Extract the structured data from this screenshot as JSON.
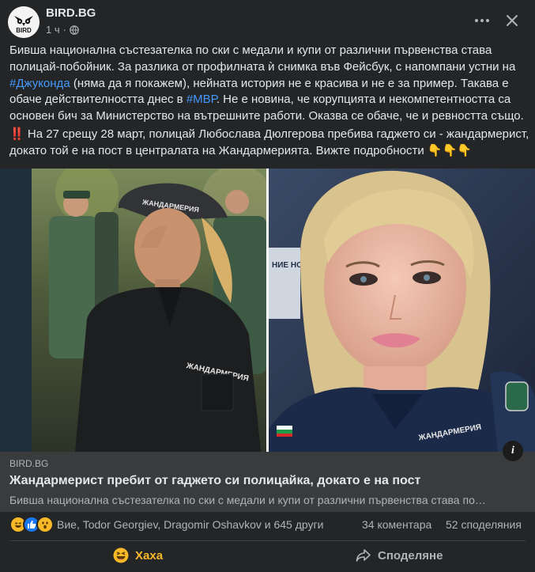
{
  "header": {
    "page_name": "BIRD.BG",
    "avatar_text": "BIRD",
    "time": "1 ч",
    "dot": "·"
  },
  "post": {
    "paragraph1_part1": "Бивша национална състезателка по ски с медали и купи от различни първенства става полицай-побойник. За разлика от профилната ѝ снимка във Фейсбук, с напомпани устни на ",
    "hashtag1": "#Джуконда",
    "paragraph1_part2": " (няма да я покажем), нейната история не е красива и не е за пример. Такава е обаче действителността днес в ",
    "hashtag2": "#МВР",
    "paragraph1_part3": ". Не е новина, че корупцията и некомпетентността са основен бич за Министерство на вътрешните работи. Оказва се обаче, че и ревността също.",
    "paragraph2_icon": "‼️",
    "paragraph2": " На 27 срещу 28 март, полицай Любослава Дюлгерова пребива гаджето си - жандармерист, докато той е на пост в централата на Жандармерията. Вижте подробности ",
    "paragraph2_emoji": "👇👇👇"
  },
  "images": {
    "left_cap_text": "ЖАНДАРМЕРИЯ",
    "left_shirt_text": "ЖАНДАРМЕРИЯ",
    "right_shirt_text": "ЖАНДАРМЕРИЯ",
    "right_sign_text": "НИЕ НО НЕ МО"
  },
  "link_preview": {
    "domain": "BIRD.BG",
    "title": "Жандармерист пребит от гаджето си полицайка, докато е на пост",
    "description": "Бивша национална състезателка по ски с медали и купи от различни първенства става по…",
    "info_label": "i"
  },
  "stats": {
    "reactors": "Вие, Todor Georgiev, Dragomir Oshavkov и 645 други",
    "comments": "34 коментара",
    "shares": "52 споделяния"
  },
  "actions": {
    "haha_label": "Хаха",
    "share_label": "Споделяне"
  },
  "colors": {
    "background": "#242526",
    "link_preview_bg": "#3a3b3c",
    "hashtag": "#4599ff",
    "haha": "#f7b928",
    "secondary_text": "#b0b3b8"
  }
}
